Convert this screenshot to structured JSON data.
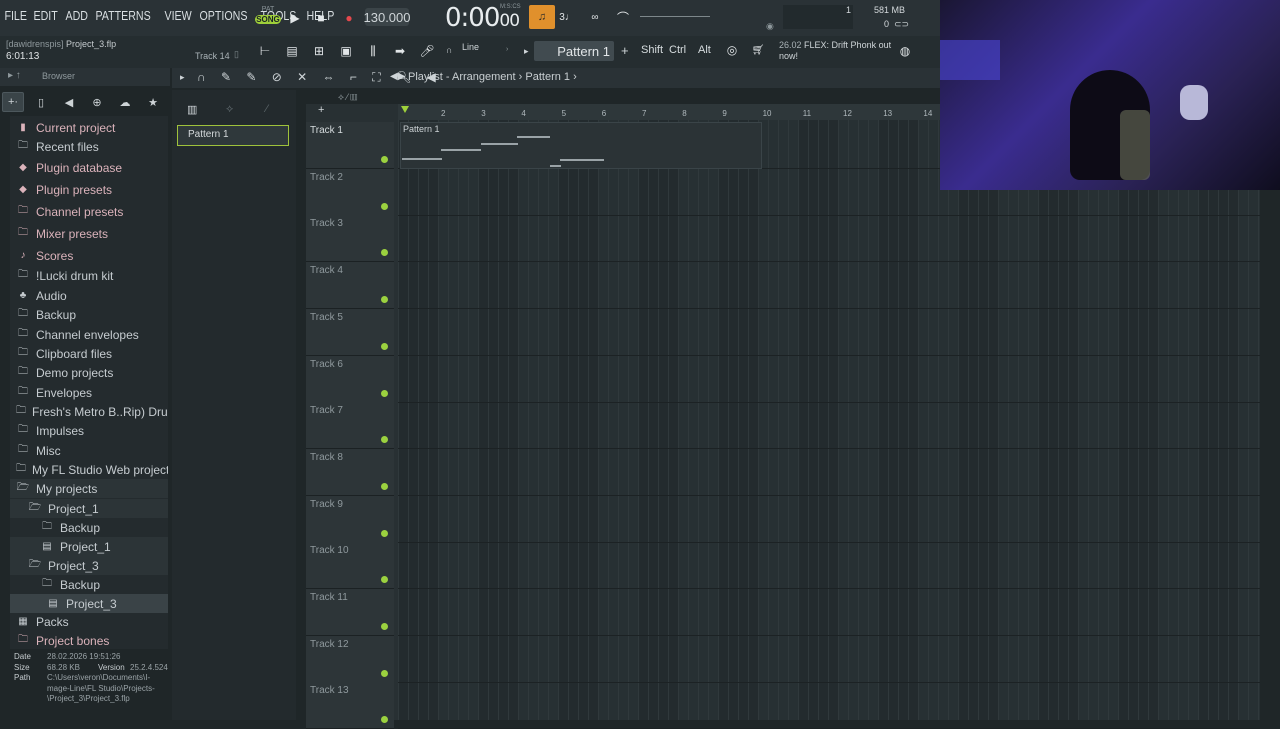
{
  "menu": [
    "FILE",
    "EDIT",
    "ADD",
    "PATTERNS",
    "VIEW",
    "OPTIONS",
    "TOOLS",
    "HELP"
  ],
  "transport": {
    "pat_label": "PAT",
    "song_label": "SONG",
    "tempo": "130.000",
    "time": "0:00",
    "time_small": "00",
    "time_unit": "M:S:CS"
  },
  "stats": {
    "cpu_digit": "1",
    "ram": "581 MB",
    "poly": "0"
  },
  "project": {
    "owner": "[dawidrenspis]",
    "file": "Project_3.flp",
    "elapsed": "6:01:13",
    "track_hint": "Track 14"
  },
  "toolbar": {
    "snap": "Line",
    "pattern": "Pattern 1",
    "keys": [
      "Shift",
      "Ctrl",
      "Alt"
    ]
  },
  "news": {
    "date": "26.02",
    "text": "FLEX: Drift Phonk out now!"
  },
  "browser": {
    "title": "Browser",
    "items": [
      {
        "label": "Current project",
        "icon": "project-icon",
        "red": true
      },
      {
        "label": "Recent files",
        "icon": "folder-icon"
      },
      {
        "label": "Plugin database",
        "icon": "plugin-icon",
        "red": true
      },
      {
        "label": "Plugin presets",
        "icon": "plugin-icon",
        "red": true
      },
      {
        "label": "Channel presets",
        "icon": "folder-icon",
        "red": true
      },
      {
        "label": "Mixer presets",
        "icon": "folder-icon",
        "red": true
      },
      {
        "label": "Scores",
        "icon": "note-icon",
        "red": true
      },
      {
        "label": "!Lucki drum kit",
        "icon": "folder-icon"
      },
      {
        "label": "Audio",
        "icon": "audio-icon"
      },
      {
        "label": "Backup",
        "icon": "folder-icon"
      },
      {
        "label": "Channel envelopes",
        "icon": "folder-icon"
      },
      {
        "label": "Clipboard files",
        "icon": "folder-icon"
      },
      {
        "label": "Demo projects",
        "icon": "folder-icon"
      },
      {
        "label": "Envelopes",
        "icon": "folder-icon"
      },
      {
        "label": "Fresh's Metro B..Rip) Drum Kit",
        "icon": "folder-icon"
      },
      {
        "label": "Impulses",
        "icon": "folder-icon"
      },
      {
        "label": "Misc",
        "icon": "folder-icon"
      },
      {
        "label": "My FL Studio Web projects",
        "icon": "folder-icon"
      },
      {
        "label": "My projects",
        "icon": "folder-open-icon"
      },
      {
        "label": "Project_1",
        "icon": "folder-open-icon"
      },
      {
        "label": "Backup",
        "icon": "folder-icon"
      },
      {
        "label": "Project_1",
        "icon": "file-icon"
      },
      {
        "label": "Project_3",
        "icon": "folder-open-icon"
      },
      {
        "label": "Backup",
        "icon": "folder-icon"
      },
      {
        "label": "Project_3",
        "icon": "file-icon"
      },
      {
        "label": "Packs",
        "icon": "packs-icon"
      },
      {
        "label": "Project bones",
        "icon": "folder-icon",
        "red": true
      }
    ],
    "info": {
      "date_label": "Date",
      "date": "28.02.2026 19:51:26",
      "size_label": "Size",
      "size": "68.28 KB",
      "version_label": "Version",
      "version": "25.2.4.524",
      "path_label": "Path",
      "path": [
        "C:\\Users\\veron\\Documents\\I-",
        "mage-Line\\FL Studio\\Projects-",
        "\\Project_3\\Project_3.flp"
      ]
    }
  },
  "playlist": {
    "breadcrumb_a": "Playlist - Arrangement",
    "breadcrumb_b": "Pattern 1",
    "picker_pattern": "Pattern 1",
    "clip_label": "Pattern 1",
    "bars": [
      "2",
      "3",
      "4",
      "5",
      "6",
      "7",
      "8",
      "9",
      "10",
      "11",
      "12",
      "13",
      "14"
    ],
    "tracks": [
      "Track 1",
      "Track 2",
      "Track 3",
      "Track 4",
      "Track 5",
      "Track 6",
      "Track 7",
      "Track 8",
      "Track 9",
      "Track 10",
      "Track 11",
      "Track 12",
      "Track 13"
    ]
  }
}
